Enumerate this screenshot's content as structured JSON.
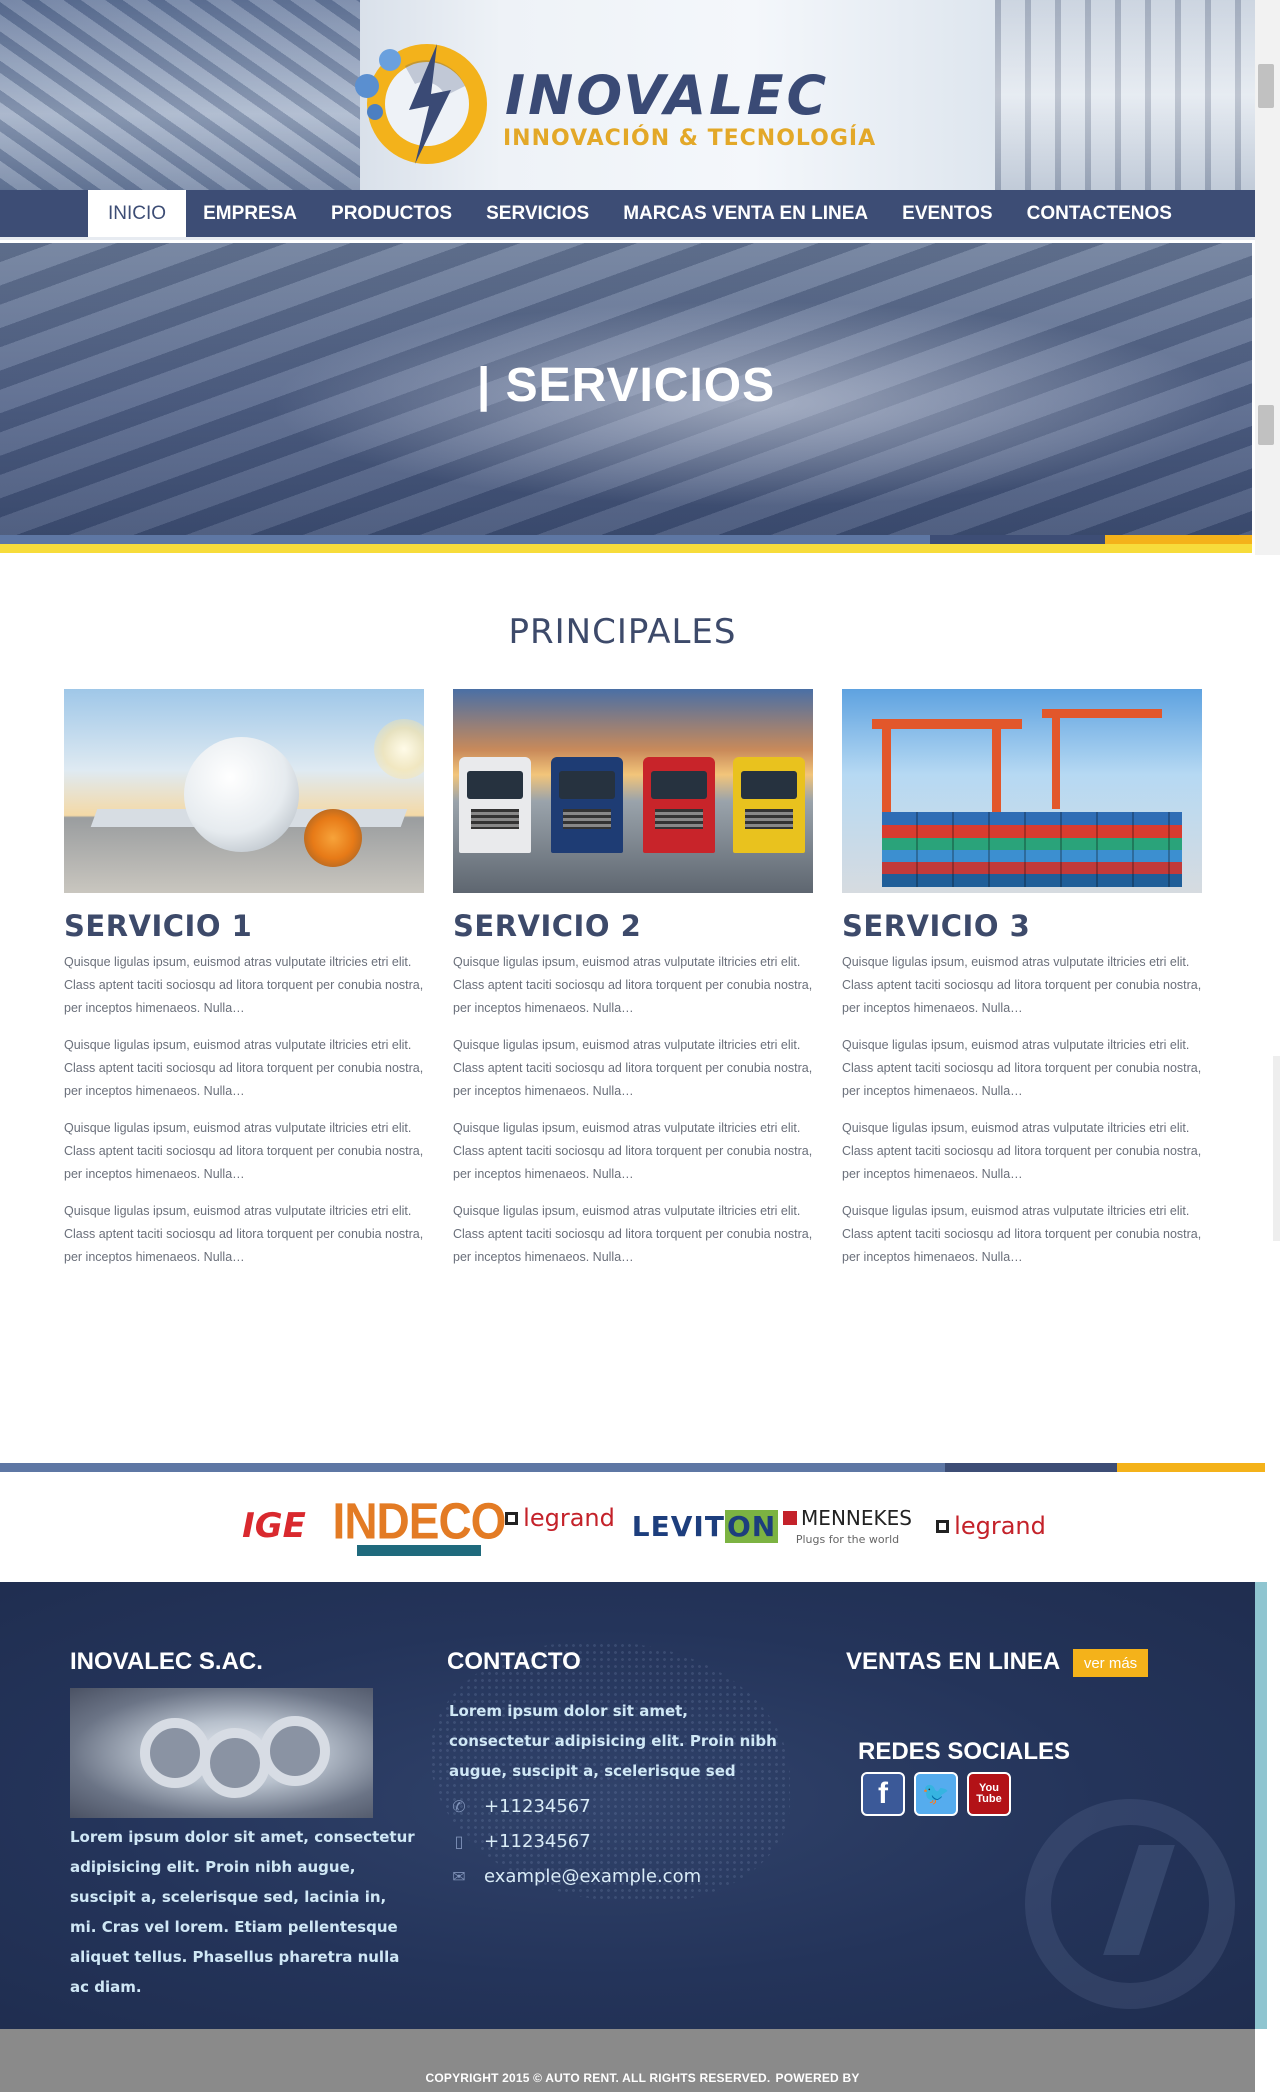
{
  "brand": {
    "name": "INOVALEC",
    "tagline": "INNOVACIÓN & TECNOLOGÍA"
  },
  "nav": {
    "items": [
      {
        "label": "INICIO",
        "active": true
      },
      {
        "label": "EMPRESA",
        "active": false
      },
      {
        "label": "PRODUCTOS",
        "active": false
      },
      {
        "label": "SERVICIOS",
        "active": false
      },
      {
        "label": "MARCAS VENTA EN LINEA",
        "active": false
      },
      {
        "label": "EVENTOS",
        "active": false
      },
      {
        "label": "CONTACTENOS",
        "active": false
      }
    ]
  },
  "hero": {
    "title": "| SERVICIOS"
  },
  "principales": {
    "title": "PRINCIPALES",
    "paragraph": "Quisque ligulas ipsum, euismod atras vulputate iltricies etri elit. Class aptent taciti sociosqu ad litora torquent per conubia nostra, per inceptos himenaeos. Nulla…",
    "cards": [
      {
        "title": "SERVICIO 1",
        "image": "airplane-photo"
      },
      {
        "title": "SERVICIO 2",
        "image": "trucks-photo"
      },
      {
        "title": "SERVICIO 3",
        "image": "port-containers-photo"
      }
    ]
  },
  "brands": [
    "IGE",
    "INDECO",
    "legrand",
    "LEVITON",
    "MENNEKES",
    "legrand"
  ],
  "brand_extra": {
    "leviton_main": "LEVIT",
    "leviton_highlight": "ON",
    "mennekes_tagline": "Plugs for the world"
  },
  "footer": {
    "company": {
      "title": "INOVALEC S.AC.",
      "text": "Lorem ipsum dolor sit amet, consectetur adipisicing elit. Proin nibh augue, suscipit a, scelerisque sed, lacinia in, mi. Cras vel lorem. Etiam pellentesque aliquet tellus. Phasellus pharetra nulla ac diam."
    },
    "contact": {
      "title": "CONTACTO",
      "text": "Lorem ipsum dolor sit amet, consectetur adipisicing elit. Proin nibh augue, suscipit a, scelerisque sed",
      "phone": "+11234567",
      "mobile": "+11234567",
      "email": "example@example.com"
    },
    "sales": {
      "title": "VENTAS EN LINEA",
      "button": "ver más"
    },
    "social": {
      "title": "REDES SOCIALES",
      "youtube_label": "You Tube"
    }
  },
  "copyright": {
    "text": "COPYRIGHT 2015 © AUTO RENT. ALL RIGHTS RESERVED.",
    "powered": "POWERED BY"
  },
  "colors": {
    "navy": "#3d4d75",
    "accent_yellow": "#f4b21a",
    "steel_blue": "#5e77a4",
    "footer_bg": "#24345a"
  }
}
